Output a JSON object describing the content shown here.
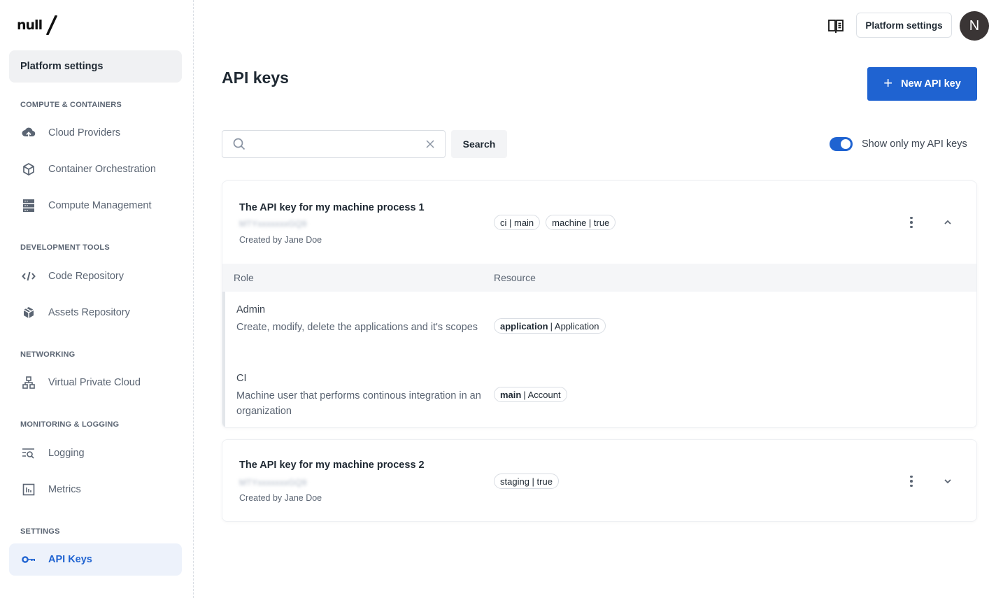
{
  "brand": {
    "logo_text": "null/"
  },
  "sidebar": {
    "top_item": "Platform settings",
    "sections": [
      {
        "title": "COMPUTE & CONTAINERS",
        "items": [
          {
            "label": "Cloud Providers",
            "icon": "cloud-upload-icon"
          },
          {
            "label": "Container Orchestration",
            "icon": "cube-icon"
          },
          {
            "label": "Compute Management",
            "icon": "server-icon"
          }
        ]
      },
      {
        "title": "DEVELOPMENT TOOLS",
        "items": [
          {
            "label": "Code Repository",
            "icon": "code-icon"
          },
          {
            "label": "Assets Repository",
            "icon": "package-icon"
          }
        ]
      },
      {
        "title": "NETWORKING",
        "items": [
          {
            "label": "Virtual Private Cloud",
            "icon": "network-icon"
          }
        ]
      },
      {
        "title": "MONITORING & LOGGING",
        "items": [
          {
            "label": "Logging",
            "icon": "log-search-icon"
          },
          {
            "label": "Metrics",
            "icon": "bar-chart-icon"
          }
        ]
      },
      {
        "title": "SETTINGS",
        "items": [
          {
            "label": "API Keys",
            "icon": "key-icon",
            "active": true
          }
        ]
      }
    ]
  },
  "header": {
    "docs_icon": "book-icon",
    "platform_settings_button": "Platform settings",
    "avatar_initial": "N"
  },
  "main": {
    "title": "API keys",
    "new_button": "New API key",
    "search": {
      "value": "",
      "placeholder": "",
      "button": "Search"
    },
    "toggle": {
      "label": "Show only my API keys",
      "on": true
    },
    "columns": {
      "role": "Role",
      "resource": "Resource"
    },
    "keys": [
      {
        "name": "The API key for my machine process 1",
        "masked_key": "MTYxxxxxxxGQ9",
        "created_by": "Created by Jane Doe",
        "tags": [
          "ci | main",
          "machine | true"
        ],
        "expanded": true,
        "roles": [
          {
            "name": "Admin",
            "description": "Create, modify, delete the applications and it's scopes",
            "resource_bold": "application",
            "resource_rest": "| Application"
          },
          {
            "name": "CI",
            "description": "Machine user that performs continous integration in an organization",
            "resource_bold": "main",
            "resource_rest": "| Account"
          }
        ]
      },
      {
        "name": "The API key for my machine process 2",
        "masked_key": "MTYxxxxxxxGQ9",
        "created_by": "Created by Jane Doe",
        "tags": [
          "staging | true"
        ],
        "expanded": false
      }
    ]
  },
  "colors": {
    "accent": "#1f63d1",
    "active_bg": "#edf2fb",
    "avatar_bg": "#3a3535"
  }
}
